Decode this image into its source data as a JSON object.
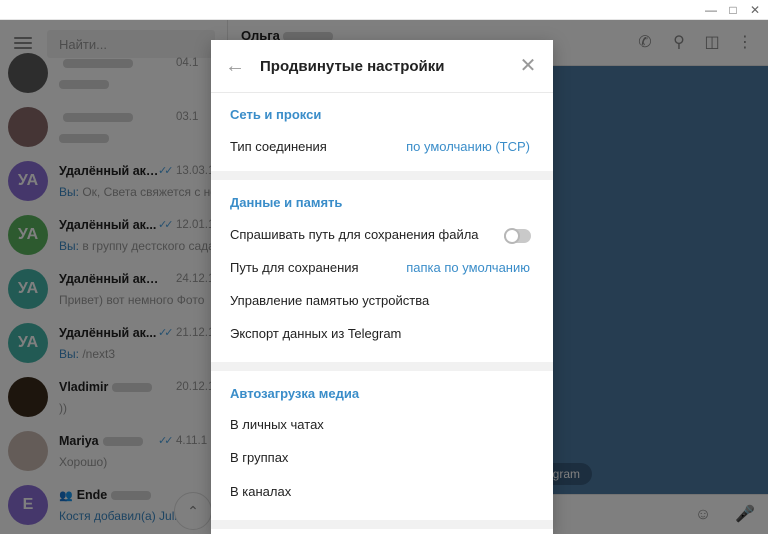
{
  "sidebar": {
    "search_placeholder": "Найти...",
    "chats": [
      {
        "name": "",
        "date": "04.1",
        "msg": "",
        "avatar_text": "",
        "avatar_color": "#5a5a5a",
        "read": false,
        "prefix": ""
      },
      {
        "name": "",
        "date": "03.1",
        "msg": "",
        "avatar_text": "",
        "avatar_color": "#8a6a6a",
        "read": false,
        "prefix": ""
      },
      {
        "name": "Удалённый акк...",
        "date": "13.03.1",
        "msg": "Ок, Света свяжется с ней",
        "avatar_text": "УА",
        "avatar_color": "#8b6fd6",
        "read": true,
        "prefix": "Вы:"
      },
      {
        "name": "Удалённый ак...",
        "date": "12.01.1",
        "msg": "в группу дестского сада.",
        "avatar_text": "УА",
        "avatar_color": "#5ab55e",
        "read": true,
        "prefix": "Вы:"
      },
      {
        "name": "Удалённый аккау...",
        "date": "24.12.1",
        "msg": "Привет) вот немного Фото",
        "avatar_text": "УА",
        "avatar_color": "#44b4a8",
        "read": false,
        "prefix": ""
      },
      {
        "name": "Удалённый ак...",
        "date": "21.12.1",
        "msg": "/next3",
        "avatar_text": "УА",
        "avatar_color": "#44b4a8",
        "read": true,
        "prefix": "Вы:"
      },
      {
        "name": "Vladimir",
        "date": "20.12.1",
        "msg": "))",
        "avatar_text": "",
        "avatar_color": "#3a2a1a",
        "read": false,
        "prefix": ""
      },
      {
        "name": "Mariya",
        "date": "4.11.1",
        "msg": "Хорошо)",
        "avatar_text": "",
        "avatar_color": "#c8b8b0",
        "read": true,
        "prefix": ""
      },
      {
        "name": "Ende",
        "date": "",
        "msg": "Костя добавил(а) Julia",
        "avatar_text": "E",
        "avatar_color": "#8b6fd6",
        "read": false,
        "prefix": "",
        "group": true
      }
    ]
  },
  "chat_header": {
    "title": "Ольга"
  },
  "service_message": "egram",
  "dialog": {
    "title": "Продвинутые настройки",
    "sections": [
      {
        "title": "Сеть и прокси",
        "rows": [
          {
            "label": "Тип соединения",
            "value": "по умолчанию (TCP)"
          }
        ]
      },
      {
        "title": "Данные и память",
        "rows": [
          {
            "label": "Спрашивать путь для сохранения файла",
            "toggle": false
          },
          {
            "label": "Путь для сохранения",
            "value": "папка по умолчанию"
          },
          {
            "label": "Управление памятью устройства"
          },
          {
            "label": "Экспорт данных из Telegram"
          }
        ]
      },
      {
        "title": "Автозагрузка медиа",
        "rows": [
          {
            "label": "В личных чатах"
          },
          {
            "label": "В группах"
          },
          {
            "label": "В каналах"
          }
        ]
      }
    ]
  },
  "colors": {
    "accent": "#3a8dc9",
    "chat_background": "#4c7aa3",
    "section_separator": "#f1f1f1"
  }
}
